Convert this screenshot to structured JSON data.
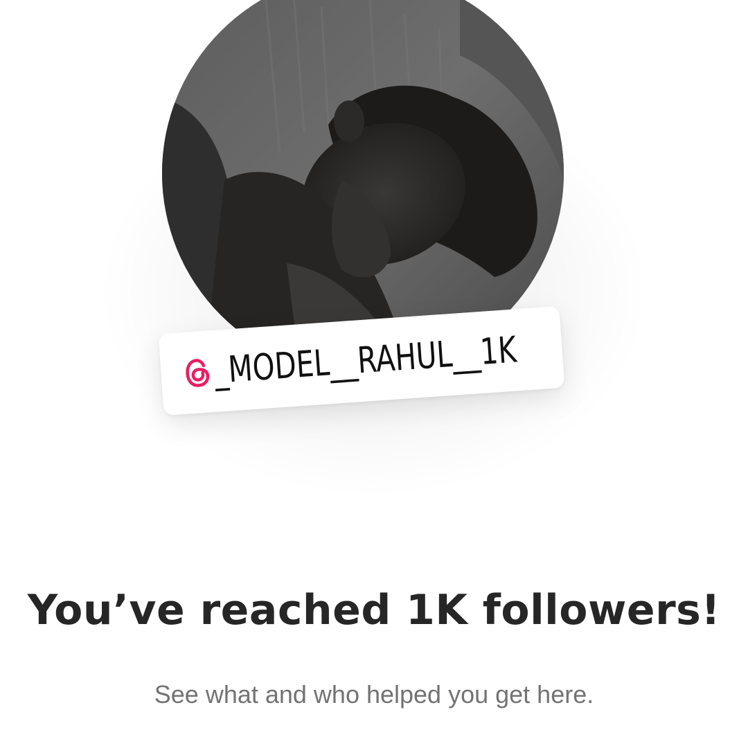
{
  "badge": {
    "platform_icon": "threads-icon",
    "handle": "@_MODEL__RAHUL__1K",
    "handle_text": "_MODEL__RAHUL__1K",
    "icon_color": "#E91E63"
  },
  "milestone": {
    "title": "You’ve reached 1K followers!",
    "subtitle": "See what and who helped you get here."
  },
  "colors": {
    "title": "#262626",
    "subtitle": "#737373",
    "background": "#FFFFFF"
  }
}
